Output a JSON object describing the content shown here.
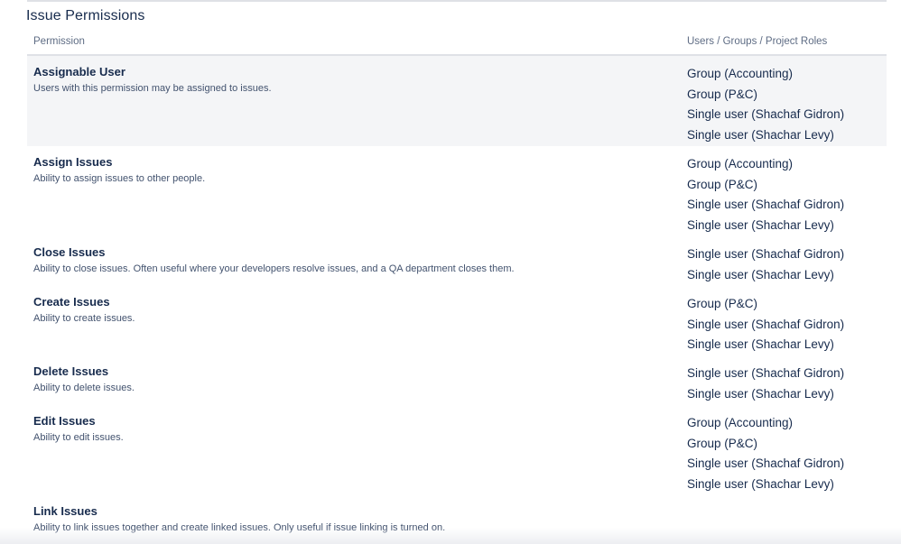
{
  "section": {
    "title": "Issue Permissions"
  },
  "table": {
    "headers": {
      "permission": "Permission",
      "users": "Users / Groups / Project Roles"
    },
    "rows": [
      {
        "name": "Assignable User",
        "description": "Users with this permission may be assigned to issues.",
        "users": [
          "Group (Accounting)",
          "Group (P&C)",
          "Single user (Shachaf Gidron)",
          "Single user (Shachar Levy)"
        ]
      },
      {
        "name": "Assign Issues",
        "description": "Ability to assign issues to other people.",
        "users": [
          "Group (Accounting)",
          "Group (P&C)",
          "Single user (Shachaf Gidron)",
          "Single user (Shachar Levy)"
        ]
      },
      {
        "name": "Close Issues",
        "description": "Ability to close issues. Often useful where your developers resolve issues, and a QA department closes them.",
        "users": [
          "Single user (Shachaf Gidron)",
          "Single user (Shachar Levy)"
        ]
      },
      {
        "name": "Create Issues",
        "description": "Ability to create issues.",
        "users": [
          "Group (P&C)",
          "Single user (Shachaf Gidron)",
          "Single user (Shachar Levy)"
        ]
      },
      {
        "name": "Delete Issues",
        "description": "Ability to delete issues.",
        "users": [
          "Single user (Shachaf Gidron)",
          "Single user (Shachar Levy)"
        ]
      },
      {
        "name": "Edit Issues",
        "description": "Ability to edit issues.",
        "users": [
          "Group (Accounting)",
          "Group (P&C)",
          "Single user (Shachaf Gidron)",
          "Single user (Shachar Levy)"
        ]
      },
      {
        "name": "Link Issues",
        "description": "Ability to link issues together and create linked issues. Only useful if issue linking is turned on.",
        "users": []
      }
    ]
  }
}
